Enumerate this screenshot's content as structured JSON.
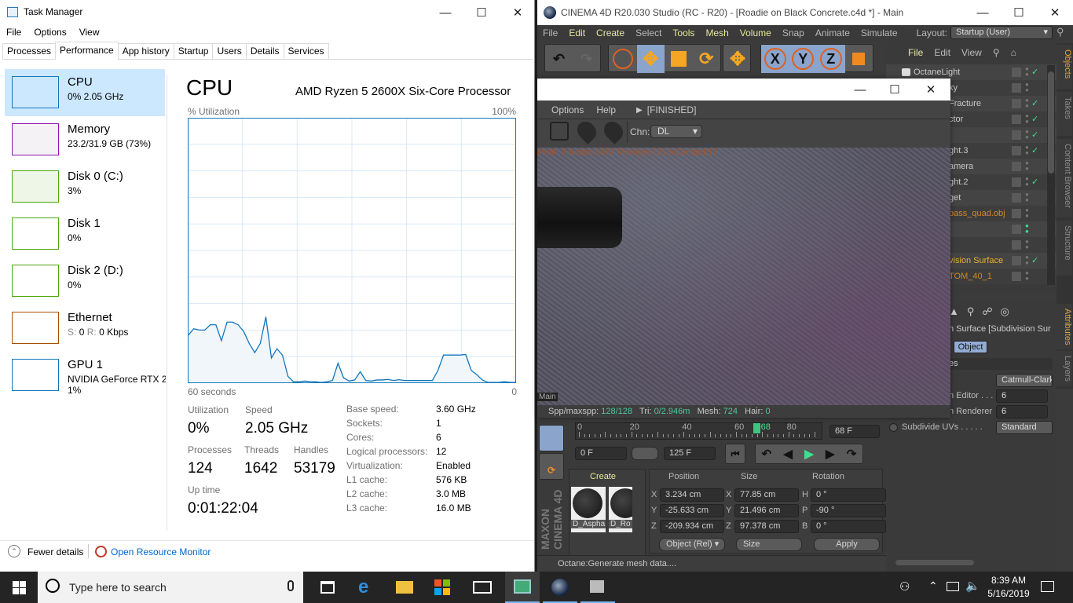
{
  "task_manager": {
    "title": "Task Manager",
    "menu": [
      "File",
      "Options",
      "View"
    ],
    "tabs": [
      "Processes",
      "Performance",
      "App history",
      "Startup",
      "Users",
      "Details",
      "Services"
    ],
    "active_tab": "Performance",
    "sidebar": [
      {
        "name": "CPU",
        "sub": "0%  2.05 GHz",
        "color": "#1177bb"
      },
      {
        "name": "Memory",
        "sub": "23.2/31.9 GB (73%)",
        "color": "#8b12ae"
      },
      {
        "name": "Disk 0 (C:)",
        "sub": "3%",
        "color": "#4da60c"
      },
      {
        "name": "Disk 1",
        "sub": "0%",
        "color": "#4da60c"
      },
      {
        "name": "Disk 2 (D:)",
        "sub": "0%",
        "color": "#4da60c"
      },
      {
        "name": "Ethernet",
        "sub_s": "S:",
        "sub_s_val": "0",
        "sub_r": "R:",
        "sub_r_val": "0 Kbps",
        "color": "#a74f01"
      },
      {
        "name": "GPU 1",
        "sub": "NVIDIA GeForce RTX 207",
        "sub2": "1%",
        "color": "#1177bb"
      }
    ],
    "main": {
      "title": "CPU",
      "processor": "AMD Ryzen 5 2600X Six-Core Processor",
      "y_label": "% Utilization",
      "y_max_label": "100%",
      "x_left_label": "60 seconds",
      "x_right_label": "0",
      "stats": {
        "utilization_label": "Utilization",
        "utilization": "0%",
        "speed_label": "Speed",
        "speed": "2.05 GHz",
        "processes_label": "Processes",
        "processes": "124",
        "threads_label": "Threads",
        "threads": "1642",
        "handles_label": "Handles",
        "handles": "53179",
        "uptime_label": "Up time",
        "uptime": "0:01:22:04"
      },
      "details": [
        {
          "k": "Base speed:",
          "v": "3.60 GHz"
        },
        {
          "k": "Sockets:",
          "v": "1"
        },
        {
          "k": "Cores:",
          "v": "6"
        },
        {
          "k": "Logical processors:",
          "v": "12"
        },
        {
          "k": "Virtualization:",
          "v": "Enabled"
        },
        {
          "k": "L1 cache:",
          "v": "576 KB"
        },
        {
          "k": "L2 cache:",
          "v": "3.0 MB"
        },
        {
          "k": "L3 cache:",
          "v": "16.0 MB"
        }
      ]
    },
    "chart_data": {
      "type": "area",
      "ylim": [
        0,
        100
      ],
      "xlim": [
        60,
        0
      ],
      "grid": true,
      "color": "#1177bb",
      "values": [
        18,
        20.5,
        20,
        20,
        22,
        22,
        16,
        23,
        23,
        22,
        19.5,
        15,
        11.5,
        15,
        25,
        9.5,
        13,
        10.5,
        2.5,
        0.5,
        0.5,
        0.8,
        0.6,
        0.5,
        0.3,
        0.5,
        1,
        7.5,
        2,
        0.8,
        1.2,
        4.3,
        1,
        0.8,
        1.2,
        1.2,
        1.4,
        1,
        1.3,
        1,
        1,
        1,
        1,
        1,
        1,
        4.8,
        10.6,
        10.6,
        10.6,
        10.6,
        10.8,
        4.8,
        3.2,
        1.2,
        0.3,
        0.3,
        0.3,
        0.6,
        0.3,
        0.3
      ]
    },
    "footer": {
      "fewer": "Fewer details",
      "monitor": "Open Resource Monitor"
    }
  },
  "c4d": {
    "title": "CINEMA 4D R20.030 Studio (RC - R20) - [Roadie on Black Concrete.c4d *] - Main",
    "menu": [
      "File",
      "Edit",
      "Create",
      "Select",
      "Tools",
      "Mesh",
      "Volume",
      "Snap",
      "Animate",
      "Simulate"
    ],
    "layout_label": "Layout:",
    "layout_value": "Startup (User)",
    "toolbar_axes": [
      "X",
      "Y",
      "Z"
    ],
    "objects_menu": [
      "File",
      "Edit",
      "View"
    ],
    "objects": [
      {
        "label": "OctaneLight",
        "color": "#c8c8c8",
        "check": true
      },
      {
        "label": "ky",
        "color": "#c8c8c8",
        "check": false
      },
      {
        "label": "Fracture",
        "color": "#c8c8c8",
        "check": true
      },
      {
        "label": "ctor",
        "color": "#c8c8c8",
        "check": true
      },
      {
        "label": "",
        "color": "#c8c8c8",
        "check": true
      },
      {
        "label": "ght.3",
        "color": "#c8c8c8",
        "check": true
      },
      {
        "label": "amera",
        "color": "#c8c8c8",
        "check": false
      },
      {
        "label": "ght.2",
        "color": "#c8c8c8",
        "check": true
      },
      {
        "label": "get",
        "color": "#c8c8c8",
        "check": false
      },
      {
        "label": "pass_quad.obj",
        "color": "#d08a2a",
        "check": false
      },
      {
        "label": "",
        "color": "#c8c8c8",
        "check": false
      },
      {
        "label": "",
        "color": "#c8c8c8",
        "check": false
      },
      {
        "label": "vision Surface",
        "color": "#e8b030",
        "check": true
      },
      {
        "label": "TOM_40_1",
        "color": "#d08a2a",
        "check": false
      }
    ],
    "side_tabs": [
      "Objects",
      "Takes",
      "Content Browser",
      "Structure"
    ],
    "attr_tabs": [
      "Attributes",
      "Layers"
    ],
    "attributes": {
      "title": "n Surface [Subdivision Sur",
      "tab": "Object",
      "section": "es",
      "rows": [
        {
          "k": "",
          "v": "Catmull-Clark"
        },
        {
          "k": "n Editor . . .",
          "v": "6"
        },
        {
          "k": "n Renderer",
          "v": "6"
        },
        {
          "k": "Subdivide UVs . . . . .",
          "v": "Standard"
        }
      ]
    },
    "octane": {
      "menu": [
        "Options",
        "Help"
      ],
      "status": "[FINISHED]",
      "chn_label": "Chn:",
      "chn_value": "DL",
      "overlay": "Mesh:3 Nodes:1467 Movable:721 txCached:17",
      "stats": {
        "spp_label": "Spp/maxspp:",
        "spp": "128/128",
        "tri_label": "Tri:",
        "tri": "0/2.946m",
        "mesh_label": "Mesh:",
        "mesh": "724",
        "hair_label": "Hair:",
        "hair": "0"
      },
      "main_tag": "Main"
    },
    "timeline": {
      "ticks": [
        "0",
        "20",
        "40",
        "60",
        "68",
        "80"
      ],
      "current": "68 F",
      "start": "0 F",
      "end": "125 F",
      "current_frame": 68,
      "max_frame": 90
    },
    "materials": {
      "create": "Create",
      "items": [
        "D_Aspha",
        "D_Ro"
      ]
    },
    "coords": {
      "headers": [
        "Position",
        "Size",
        "Rotation"
      ],
      "position": [
        {
          "a": "X",
          "v": "3.234 cm"
        },
        {
          "a": "Y",
          "v": "-25.633 cm"
        },
        {
          "a": "Z",
          "v": "-209.934 cm"
        }
      ],
      "size": [
        {
          "a": "X",
          "v": "77.85 cm"
        },
        {
          "a": "Y",
          "v": "21.496 cm"
        },
        {
          "a": "Z",
          "v": "97.378 cm"
        }
      ],
      "rotation": [
        {
          "a": "H",
          "v": "0 °"
        },
        {
          "a": "P",
          "v": "-90 °"
        },
        {
          "a": "B",
          "v": "0 °"
        }
      ],
      "mode": "Object (Rel)",
      "size_mode": "Size",
      "apply": "Apply"
    },
    "logo": "MAXON CINEMA 4D",
    "status": "Octane:Generate mesh data...."
  },
  "taskbar": {
    "search_placeholder": "Type here to search",
    "time": "8:39 AM",
    "date": "5/16/2019"
  }
}
